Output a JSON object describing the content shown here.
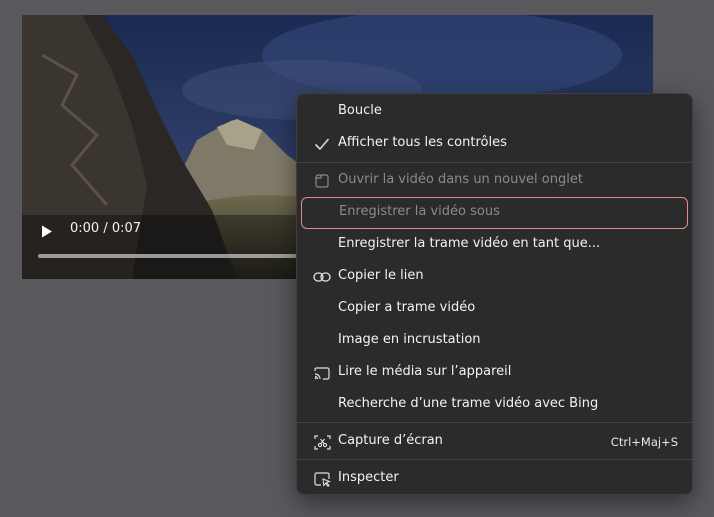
{
  "video": {
    "time": "0:00 / 0:07",
    "progress": 0
  },
  "menu": {
    "loop": "Boucle",
    "show_all_controls": "Afficher tous les contrôles",
    "open_new_tab": "Ouvrir la vidéo dans un nouvel onglet",
    "save_video_as": "Enregistrer la vidéo sous",
    "save_frame_as": "Enregistrer la trame vidéo en tant que...",
    "copy_link": "Copier le lien",
    "copy_frame": "Copier a trame vidéo",
    "pip": "Image en incrustation",
    "cast": "Lire le média sur l’appareil",
    "search_bing": "Recherche d’une trame vidéo avec Bing",
    "screenshot": "Capture d’écran",
    "screenshot_shortcut": "Ctrl+Maj+S",
    "inspect": "Inspecter"
  },
  "icons": {
    "show_all_controls": "checkmark-icon",
    "open_new_tab": "new-tab-icon",
    "copy_link": "link-icon",
    "cast": "cast-icon",
    "screenshot": "screenshot-icon",
    "inspect": "inspect-icon"
  },
  "colors": {
    "menu_bg": "#2b2b2b",
    "highlight_border": "#e58c8a",
    "disabled_text": "#8b8b8b"
  }
}
